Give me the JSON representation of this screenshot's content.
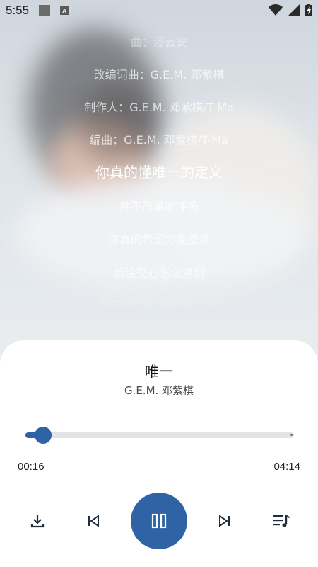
{
  "status_bar": {
    "time": "5:55",
    "notification_badge": "A"
  },
  "lyrics": {
    "lines": [
      "曲：潘云安",
      "改编词曲：G.E.M. 邓紫棋",
      "制作人：G.E.M. 邓紫棋/T-Ma",
      "编曲：G.E.M. 邓紫棋/T-Ma",
      "你真的懂唯一的定义",
      "并不简单如呼吸",
      "你真的希望你能厘清",
      "若没交心怎么说明",
      "我真的爱你 句句不轻易"
    ],
    "active_index": 4
  },
  "player": {
    "title": "唯一",
    "artist": "G.E.M. 邓紫棋",
    "elapsed": "00:16",
    "duration": "04:14",
    "progress": 0.0669,
    "accent_color": "#2f63a6"
  },
  "controls": {
    "download_icon": "download-icon",
    "prev_icon": "skip-previous-icon",
    "play_pause_icon": "pause-icon",
    "next_icon": "skip-next-icon",
    "playlist_icon": "playlist-icon"
  }
}
